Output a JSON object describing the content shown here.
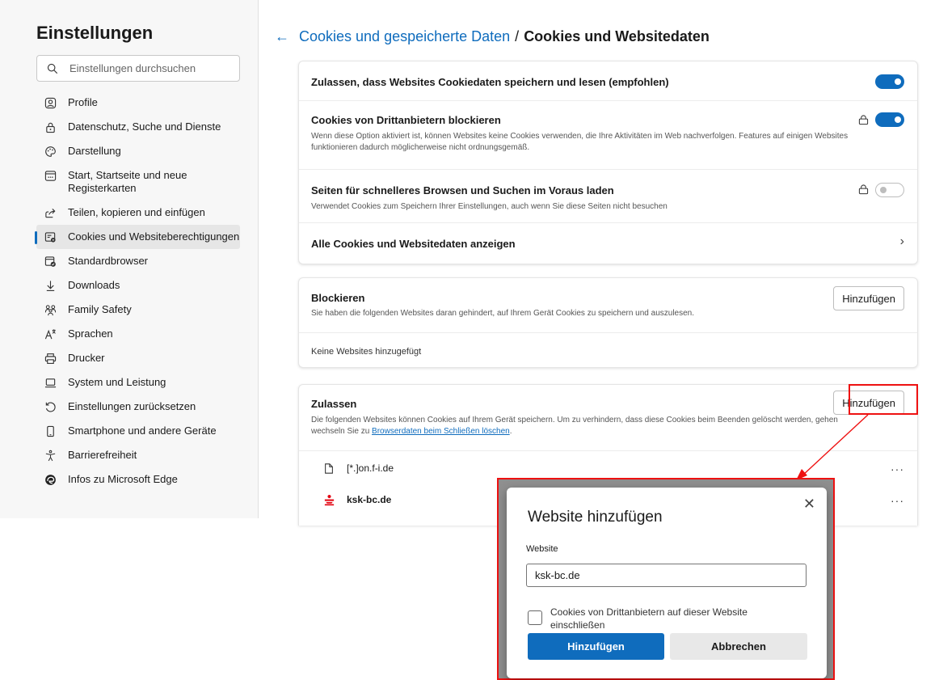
{
  "sidebar": {
    "title": "Einstellungen",
    "search_placeholder": "Einstellungen durchsuchen",
    "items": [
      {
        "label": "Profile",
        "icon": "profile-icon"
      },
      {
        "label": "Datenschutz, Suche und Dienste",
        "icon": "lock-icon"
      },
      {
        "label": "Darstellung",
        "icon": "palette-icon"
      },
      {
        "label": "Start, Startseite und neue Registerkarten",
        "icon": "new-tab-icon"
      },
      {
        "label": "Teilen, kopieren und einfügen",
        "icon": "share-icon"
      },
      {
        "label": "Cookies und Websiteberechtigungen",
        "icon": "cookie-permissions-icon"
      },
      {
        "label": "Standardbrowser",
        "icon": "browser-icon"
      },
      {
        "label": "Downloads",
        "icon": "download-icon"
      },
      {
        "label": "Family Safety",
        "icon": "family-icon"
      },
      {
        "label": "Sprachen",
        "icon": "language-icon"
      },
      {
        "label": "Drucker",
        "icon": "printer-icon"
      },
      {
        "label": "System und Leistung",
        "icon": "laptop-icon"
      },
      {
        "label": "Einstellungen zurücksetzen",
        "icon": "reset-icon"
      },
      {
        "label": "Smartphone und andere Geräte",
        "icon": "phone-icon"
      },
      {
        "label": "Barrierefreiheit",
        "icon": "accessibility-icon"
      },
      {
        "label": "Infos zu Microsoft Edge",
        "icon": "edge-icon"
      }
    ]
  },
  "header": {
    "back_icon": "arrow-left-icon",
    "parent": "Cookies und gespeicherte Daten",
    "separator": "/",
    "current": "Cookies und Websitedaten"
  },
  "settings_card": {
    "allow_cookies": {
      "title": "Zulassen, dass Websites Cookiedaten speichern und lesen (empfohlen)",
      "enabled": true
    },
    "block_third_party": {
      "title": "Cookies von Drittanbietern blockieren",
      "description": "Wenn diese Option aktiviert ist, können Websites keine Cookies verwenden, die Ihre Aktivitäten im Web nachverfolgen. Features auf einigen Websites funktionieren dadurch möglicherweise nicht ordnungsgemäß.",
      "enabled": true
    },
    "preload": {
      "title": "Seiten für schnelleres Browsen und Suchen im Voraus laden",
      "description": "Verwendet Cookies zum Speichern Ihrer Einstellungen, auch wenn Sie diese Seiten nicht besuchen",
      "enabled": false
    },
    "all_cookies": {
      "title": "Alle Cookies und Websitedaten anzeigen"
    }
  },
  "block_card": {
    "title": "Blockieren",
    "description": "Sie haben die folgenden Websites daran gehindert, auf Ihrem Gerät Cookies zu speichern und auszulesen.",
    "add_label": "Hinzufügen",
    "empty": "Keine Websites hinzugefügt"
  },
  "allow_card": {
    "title": "Zulassen",
    "description_1": "Die folgenden Websites können Cookies auf Ihrem Gerät speichern. Um zu verhindern, dass diese Cookies beim Beenden gelöscht werden, gehen wechseln Sie zu ",
    "description_link": "Browserdaten beim Schließen löschen",
    "description_2": ".",
    "add_label": "Hinzufügen",
    "sites": [
      {
        "name": "[*.]on.f-i.de",
        "icon": "page-icon"
      },
      {
        "name": "ksk-bc.de",
        "icon": "sparkasse-icon"
      }
    ],
    "more_label": "···"
  },
  "dialog": {
    "title": "Website hinzufügen",
    "close_label": "✕",
    "field_label": "Website",
    "field_value": "ksk-bc.de",
    "checkbox_label": "Cookies von Drittanbietern auf dieser Website einschließen",
    "checkbox_checked": false,
    "confirm_label": "Hinzufügen",
    "cancel_label": "Abbrechen"
  },
  "colors": {
    "accent": "#0f6cbd",
    "annotation": "#e11111"
  }
}
